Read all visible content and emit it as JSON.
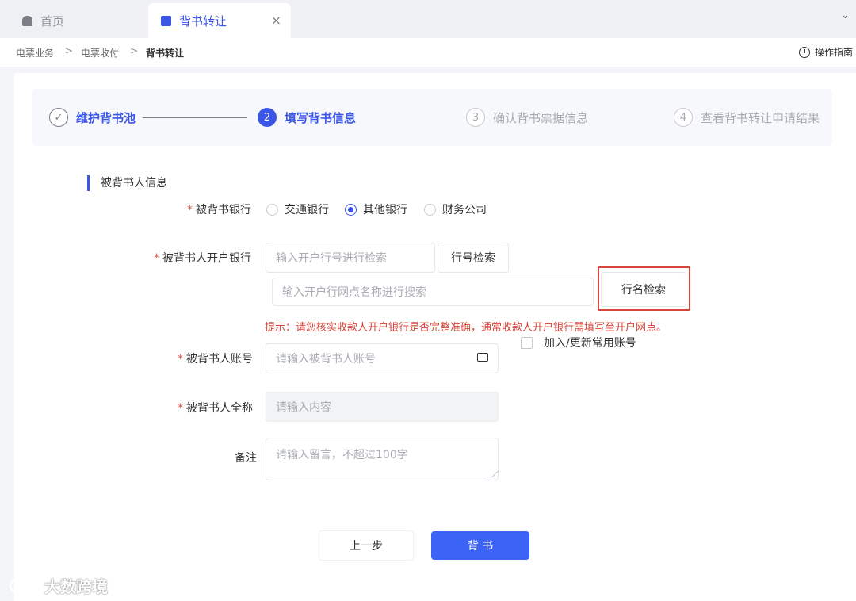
{
  "tabs": {
    "home_label": "首页",
    "active_label": "背书转让",
    "close_symbol": "×",
    "more_symbol": "⌄"
  },
  "breadcrumb": {
    "items": [
      "电票业务",
      "电票收付",
      "背书转让"
    ],
    "separator": ">",
    "guide_label": "操作指南"
  },
  "steps": [
    {
      "num": "✓",
      "label": "维护背书池",
      "state": "done"
    },
    {
      "num": "2",
      "label": "填写背书信息",
      "state": "active"
    },
    {
      "num": "3",
      "label": "确认背书票据信息",
      "state": "pending"
    },
    {
      "num": "4",
      "label": "查看背书转让申请结果",
      "state": "pending"
    }
  ],
  "form": {
    "section_title": "被背书人信息",
    "required_mark": "*",
    "bank_type": {
      "label": "被背书银行",
      "options": [
        "交通银行",
        "其他银行",
        "财务公司"
      ],
      "selected": "其他银行"
    },
    "open_bank": {
      "label": "被背书人开户银行",
      "code_placeholder": "输入开户行号进行检索",
      "code_button": "行号检索",
      "name_placeholder": "输入开户行网点名称进行搜索",
      "name_button": "行名检索"
    },
    "hint": "提示：请您核实收款人开户银行是否完整准确，通常收款人开户银行需填写至开户网点。",
    "save_account_label": "加入/更新常用账号",
    "account": {
      "label": "被背书人账号",
      "placeholder": "请输入被背书人账号"
    },
    "full_name": {
      "label": "被背书人全称",
      "placeholder": "请输入内容"
    },
    "remark": {
      "label": "备注",
      "placeholder": "请输入留言，不超过100字"
    }
  },
  "actions": {
    "prev_label": "上一步",
    "submit_label": "背 书"
  },
  "watermark": "大数跨境",
  "colors": {
    "primary": "#3b56e6",
    "submit": "#3b63f5",
    "danger": "#d5453a",
    "required": "#e0564a"
  }
}
